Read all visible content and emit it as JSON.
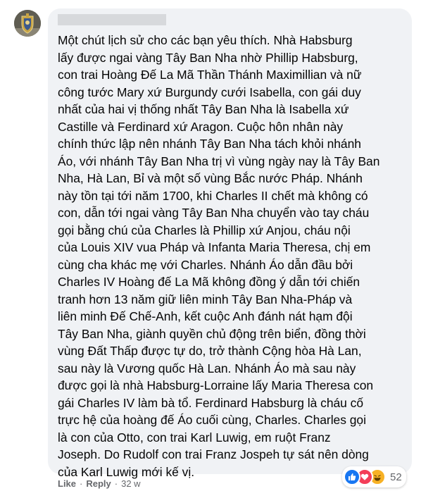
{
  "comment": {
    "lines": [
      "Một chút lịch sử cho các bạn yêu thích. Nhà Habsburg",
      "lấy được ngai vàng Tây Ban Nha nhờ Phillip Habsburg,",
      "con trai Hoàng Đế La Mã Thần Thánh Maximillian và nữ",
      "công tước Mary xứ Burgundy cưới Isabella, con gái duy",
      "nhất của hai vị thống nhất Tây Ban Nha là Isabella xứ",
      "Castille và Ferdinard xứ Aragon. Cuộc hôn nhân này",
      "chính thức lập nên nhánh Tây Ban Nha tách khỏi nhánh",
      "Áo, với nhánh Tây Ban Nha trị vì vùng ngày nay là Tây Ban",
      "Nha, Hà Lan, Bỉ và một số vùng Bắc nước Pháp. Nhánh",
      "này tồn tại tới năm 1700, khi Charles II chết mà không có",
      "con, dẫn tới ngai vàng Tây Ban Nha chuyển vào tay cháu",
      "gọi bằng chú của Charles là Phillip xứ Anjou, cháu nội",
      "của Louis XIV vua Pháp và Infanta Maria Theresa, chị em",
      "cùng cha khác mẹ với Charles. Nhánh Áo dẫn đầu bởi",
      "Charles IV Hoàng đế La Mã không đồng ý dẫn tới chiến",
      "tranh hơn 13 năm giữ liên minh Tây Ban Nha-Pháp và",
      "liên minh Đế Chế-Anh, kết cuộc Anh đánh nát hạm đội",
      "Tây Ban Nha, giành quyền chủ động trên biển, đồng thời",
      "vùng Đất Thấp được tự do, trở thành Cộng hòa Hà Lan,",
      "sau này là Vương quốc Hà Lan. Nhánh Áo mà sau này",
      "được gọi là nhà Habsburg-Lorraine lấy Maria Theresa con",
      "gái Charles IV làm bà tổ. Ferdinard Habsburg là cháu cố",
      "trực hệ của hoàng đế Áo cuối cùng, Charles. Charles gọi",
      "là con của Otto, con trai Karl Luwig, em ruột Franz",
      "Joseph. Do Rudolf con trai Franz Jospeh tự sát nên dòng",
      "của Karl Luwig mới kế vị."
    ]
  },
  "reactions": {
    "icons": [
      "like-icon",
      "love-icon",
      "haha-icon"
    ],
    "count": "52",
    "colors": {
      "like": "#1877f2",
      "love": "#f33e58",
      "haha": "#f7b125"
    }
  },
  "actions": {
    "like_label": "Like",
    "separator": "·",
    "reply_label": "Reply",
    "timestamp": "32 w"
  },
  "colors": {
    "bubble": "#f0f2f5",
    "text": "#050505",
    "meta": "#65676b"
  }
}
